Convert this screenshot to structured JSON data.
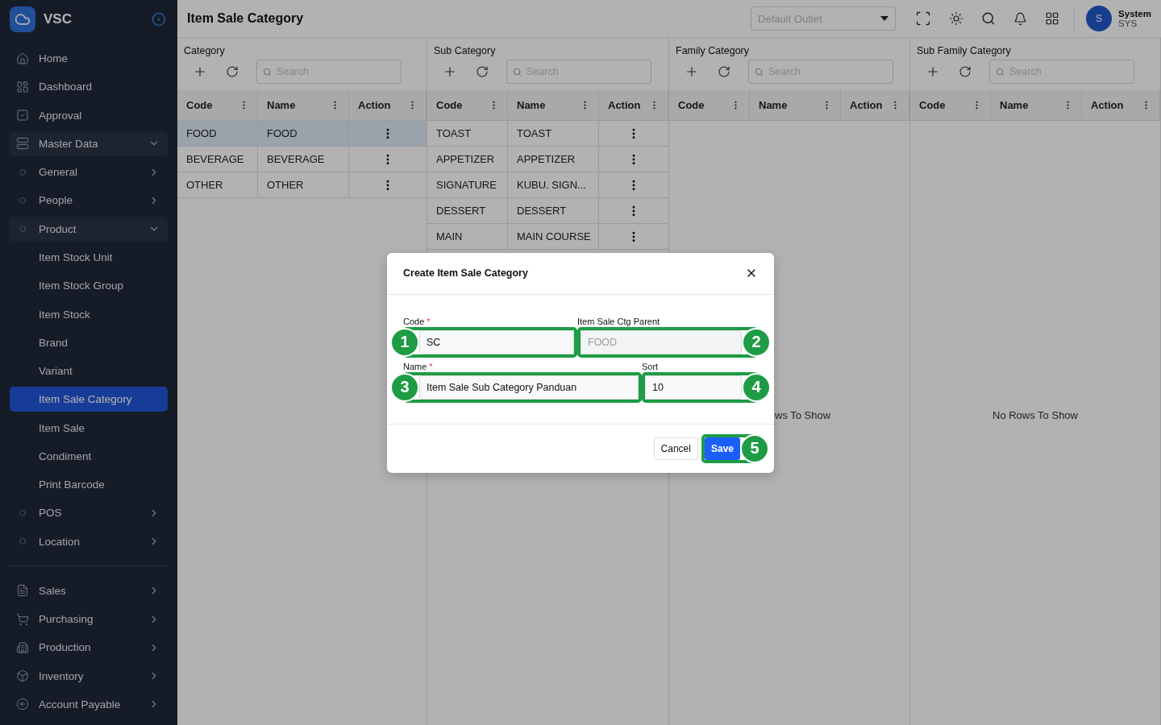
{
  "app": {
    "name": "VSC"
  },
  "sidebar": {
    "groups": [
      {
        "items": [
          {
            "label": "Home",
            "selected": false
          },
          {
            "label": "Dashboard",
            "selected": false
          },
          {
            "label": "Approval",
            "selected": false
          },
          {
            "label": "Master Data",
            "expanded": true,
            "children": [
              {
                "label": "General",
                "expanded": false
              },
              {
                "label": "People",
                "expanded": false
              },
              {
                "label": "Product",
                "expanded": true,
                "children": [
                  {
                    "label": "Item Stock Unit",
                    "selected": false
                  },
                  {
                    "label": "Item Stock Group",
                    "selected": false
                  },
                  {
                    "label": "Item Stock",
                    "selected": false
                  },
                  {
                    "label": "Brand",
                    "selected": false
                  },
                  {
                    "label": "Variant",
                    "selected": false
                  },
                  {
                    "label": "Item Sale Category",
                    "selected": true
                  },
                  {
                    "label": "Item Sale",
                    "selected": false
                  },
                  {
                    "label": "Condiment",
                    "selected": false
                  },
                  {
                    "label": "Print Barcode",
                    "selected": false
                  }
                ]
              },
              {
                "label": "POS",
                "expanded": false
              },
              {
                "label": "Location",
                "expanded": false
              }
            ]
          }
        ]
      },
      {
        "items": [
          {
            "label": "Sales",
            "expanded": false
          },
          {
            "label": "Purchasing",
            "expanded": false
          },
          {
            "label": "Production",
            "expanded": false
          },
          {
            "label": "Inventory",
            "expanded": false
          },
          {
            "label": "Account Payable",
            "expanded": false
          }
        ]
      }
    ]
  },
  "header": {
    "title": "Item Sale Category",
    "outlet": {
      "placeholder": "Default Outlet"
    },
    "user": {
      "initial": "S",
      "name": "System",
      "code": "SYS"
    }
  },
  "panels": [
    {
      "title": "Category",
      "search": {
        "placeholder": "Search"
      },
      "columns": [
        "Code",
        "Name",
        "Action"
      ],
      "rows": [
        {
          "code": "FOOD",
          "name": "FOOD",
          "selected": true
        },
        {
          "code": "BEVERAGE",
          "name": "BEVERAGE",
          "selected": false
        },
        {
          "code": "OTHER",
          "name": "OTHER",
          "selected": false
        }
      ]
    },
    {
      "title": "Sub Category",
      "search": {
        "placeholder": "Search"
      },
      "columns": [
        "Code",
        "Name",
        "Action"
      ],
      "rows": [
        {
          "code": "TOAST",
          "name": "TOAST",
          "selected": false
        },
        {
          "code": "APPETIZER",
          "name": "APPETIZER",
          "selected": false
        },
        {
          "code": "SIGNATURE",
          "name": "KUBU. SIGN...",
          "selected": false
        },
        {
          "code": "DESSERT",
          "name": "DESSERT",
          "selected": false
        },
        {
          "code": "MAIN",
          "name": "MAIN COURSE",
          "selected": false
        }
      ]
    },
    {
      "title": "Family Category",
      "search": {
        "placeholder": "Search"
      },
      "columns": [
        "Code",
        "Name",
        "Action"
      ],
      "empty_text": "ws To Show"
    },
    {
      "title": "Sub Family Category",
      "search": {
        "placeholder": "Search"
      },
      "columns": [
        "Code",
        "Name",
        "Action"
      ],
      "empty_text": "No Rows To Show"
    }
  ],
  "modal": {
    "title": "Create Item Sale Category",
    "fields": [
      {
        "label": "Code",
        "required_mark": "*",
        "value": "SC",
        "disabled": false,
        "marker": "1"
      },
      {
        "label": "Item Sale Ctg Parent",
        "value": "FOOD",
        "disabled": true,
        "marker": "2"
      },
      {
        "label": "Name",
        "required_mark": "*",
        "value": "Item Sale Sub Category Panduan",
        "disabled": false,
        "marker": "3"
      },
      {
        "label": "Sort",
        "value": "10",
        "disabled": false,
        "marker": "4"
      }
    ],
    "buttons": [
      {
        "label": "Cancel",
        "kind": "secondary"
      },
      {
        "label": "Save",
        "kind": "primary",
        "marker": "5"
      }
    ]
  }
}
